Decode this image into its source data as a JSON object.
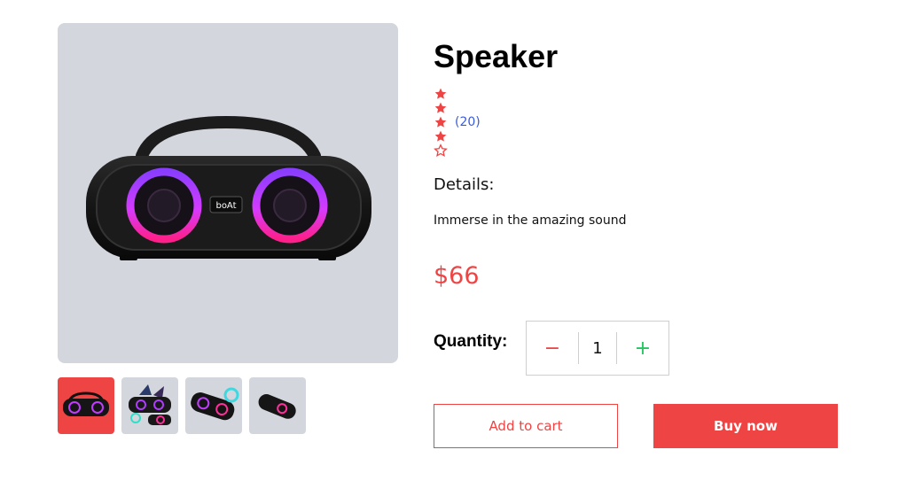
{
  "product": {
    "title": "Speaker",
    "rating": 4,
    "rating_max": 5,
    "review_count": "(20)",
    "details_heading": "Details:",
    "details_text": "Immerse in the amazing sound",
    "price": "$66"
  },
  "quantity": {
    "label": "Quantity:",
    "value": "1",
    "minus_symbol": "−",
    "plus_symbol": "+"
  },
  "actions": {
    "add_to_cart": "Add to cart",
    "buy_now": "Buy now"
  },
  "gallery": {
    "selected_index": 0,
    "thumbnails": [
      "speaker-front",
      "speaker-party",
      "speaker-angle",
      "speaker-side"
    ]
  },
  "colors": {
    "accent": "#ef4444",
    "star": "#ef4444",
    "plus": "#22c55e",
    "review_link": "#3b5bdb",
    "image_bg": "#d3d6dc"
  },
  "icons": {
    "star_filled": "star-filled-icon",
    "star_empty": "star-outline-icon",
    "minus": "minus-icon",
    "plus": "plus-icon"
  }
}
